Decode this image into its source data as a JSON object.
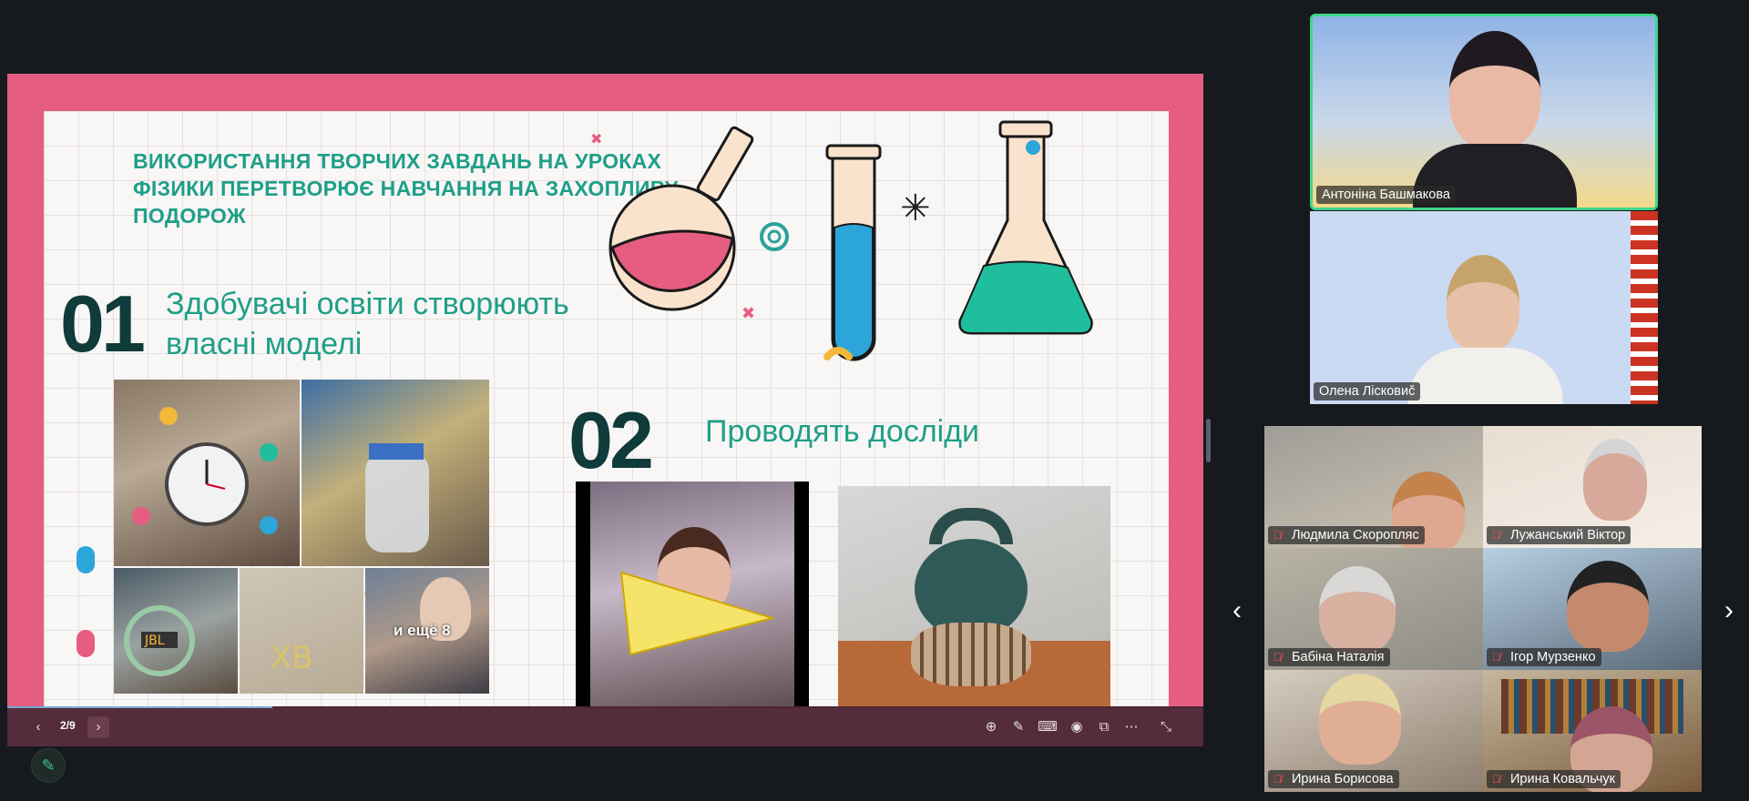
{
  "slide": {
    "title": "ВИКОРИСТАННЯ ТВОРЧИХ ЗАВДАНЬ НА УРОКАХ ФІЗИКИ ПЕРЕТВОРЮЄ НАВЧАННЯ НА ЗАХОПЛИВУ ПОДОРОЖ",
    "point1_number": "01",
    "point1_text": "Здобувачі освіти створюють власні моделі",
    "point2_number": "02",
    "point2_text": "Проводять досліди",
    "more_photos_label": "и ещё 8",
    "accent_colors": [
      "#e55d80",
      "#1e9f88",
      "#0f3b3a",
      "#2ca6da",
      "#f4b93a"
    ]
  },
  "presentation_toolbar": {
    "slide_counter": "2/9",
    "progress": 0.222,
    "icons": [
      "chevron-left-icon",
      "chevron-right-icon",
      "zoom-in-icon",
      "pen-icon",
      "keyboard-icon",
      "broadcast-icon",
      "window-icon",
      "more-icon",
      "collapse-icon"
    ]
  },
  "participants": {
    "featured": [
      {
        "name": "Антоніна Башмакова",
        "active_speaker": true
      },
      {
        "name": "Олена Лісковиč"
      }
    ],
    "grid": [
      {
        "name": "Людмила Скоропляс",
        "muted": true
      },
      {
        "name": "Лужанський Віктор",
        "muted": true
      },
      {
        "name": "Бабіна Наталія",
        "muted": true
      },
      {
        "name": "Ігор Мурзенко",
        "muted": true
      },
      {
        "name": "Ирина Борисова",
        "muted": true
      },
      {
        "name": "Ирина Ковальчук",
        "muted": true
      }
    ],
    "prev_label": "‹",
    "next_label": "›"
  },
  "colors": {
    "background": "#16191d",
    "speaker_border": "#3dd68c",
    "slide_frame": "#e55d80"
  }
}
